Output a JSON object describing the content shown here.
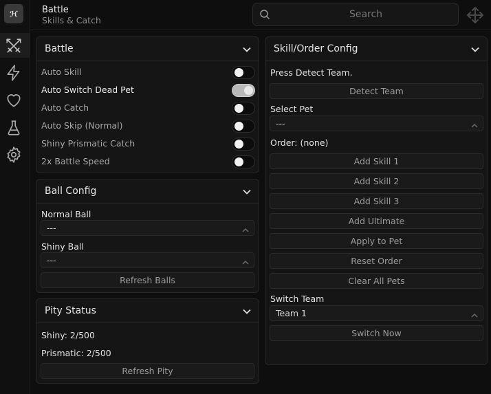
{
  "app": {
    "logo_text": "ℋ",
    "title": "Battle",
    "subtitle": "Skills & Catch"
  },
  "search": {
    "placeholder": "Search"
  },
  "rail": {
    "items": [
      {
        "icon": "crossed-swords-icon",
        "active": true
      },
      {
        "icon": "lightning-icon",
        "active": false
      },
      {
        "icon": "heart-icon",
        "active": false
      },
      {
        "icon": "flask-icon",
        "active": false
      },
      {
        "icon": "gear-icon",
        "active": false
      }
    ]
  },
  "battle": {
    "title": "Battle",
    "toggles": [
      {
        "label": "Auto Skill",
        "on": false
      },
      {
        "label": "Auto Switch Dead Pet",
        "on": true
      },
      {
        "label": "Auto Catch",
        "on": false
      },
      {
        "label": "Auto Skip (Normal)",
        "on": false
      },
      {
        "label": "Shiny Prismatic Catch",
        "on": false
      },
      {
        "label": "2x Battle Speed",
        "on": false
      }
    ]
  },
  "ball_config": {
    "title": "Ball Config",
    "normal_label": "Normal Ball",
    "normal_value": "---",
    "shiny_label": "Shiny Ball",
    "shiny_value": "---",
    "refresh_button": "Refresh Balls"
  },
  "pity": {
    "title": "Pity Status",
    "shiny": "Shiny: 2/500",
    "prismatic": "Prismatic: 2/500",
    "refresh_button": "Refresh Pity"
  },
  "skill_order": {
    "title": "Skill/Order Config",
    "hint": "Press Detect Team.",
    "detect_button": "Detect Team",
    "select_pet_label": "Select Pet",
    "select_pet_value": "---",
    "order_text": "Order: (none)",
    "buttons": [
      "Add Skill 1",
      "Add Skill 2",
      "Add Skill 3",
      "Add Ultimate",
      "Apply to Pet",
      "Reset Order",
      "Clear All Pets"
    ],
    "switch_team_label": "Switch Team",
    "switch_team_value": "Team 1",
    "switch_now_button": "Switch Now"
  }
}
